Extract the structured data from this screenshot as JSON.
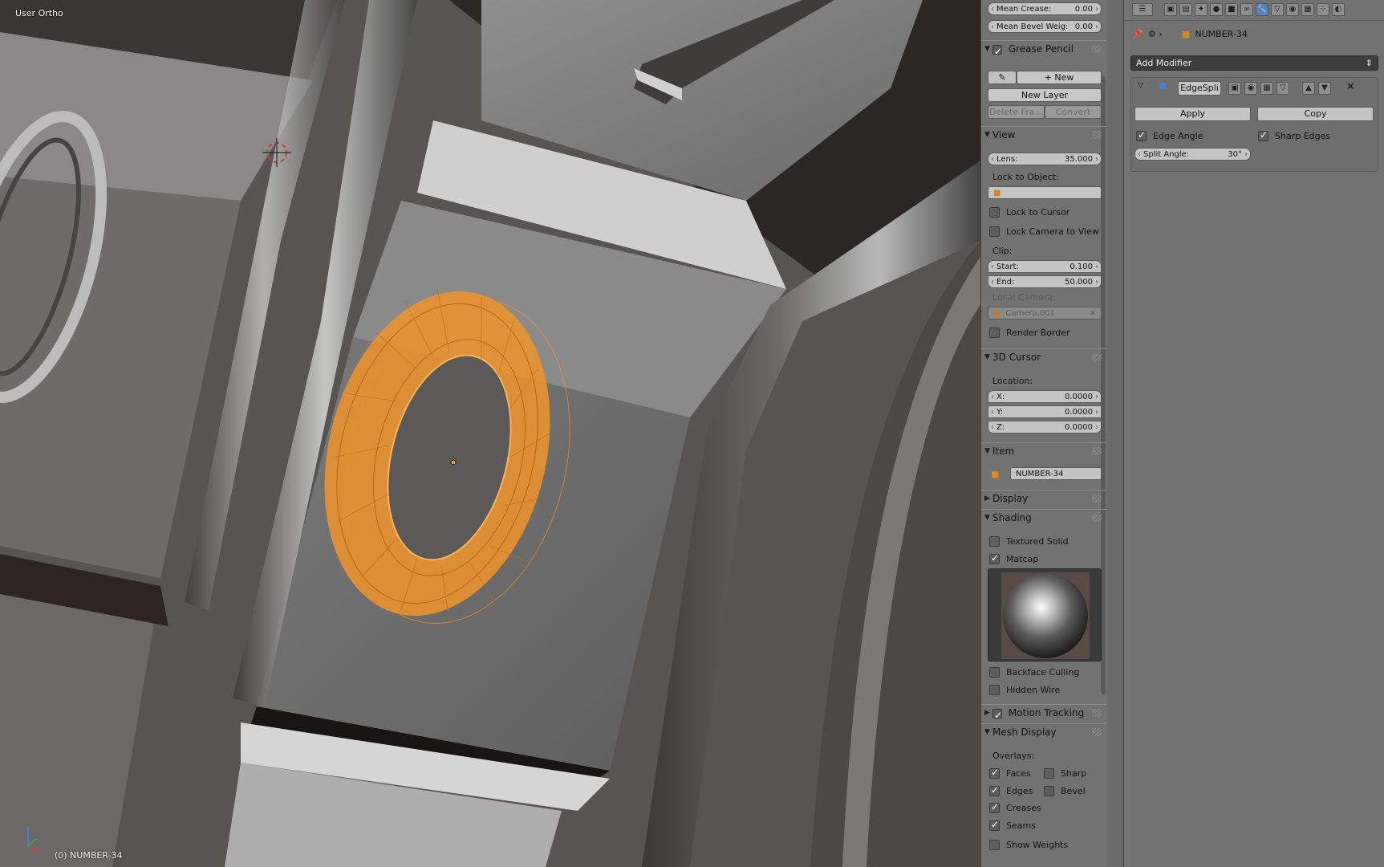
{
  "viewport": {
    "view_label": "User Ortho",
    "object_label": "(0) NUMBER-34"
  },
  "npanel": {
    "mean_crease_label": "Mean Crease:",
    "mean_crease_value": "0.00",
    "mean_bevel_label": "Mean Bevel Weig:",
    "mean_bevel_value": "0.00",
    "grease_pencil": {
      "title": "Grease Pencil",
      "new_label": "New",
      "new_layer_label": "New Layer",
      "delete_frame_label": "Delete Fra...",
      "convert_label": "Convert"
    },
    "view": {
      "title": "View",
      "lens_label": "Lens:",
      "lens_value": "35.000",
      "lock_to_object_label": "Lock to Object:",
      "lock_to_cursor_label": "Lock to Cursor",
      "lock_camera_label": "Lock Camera to View",
      "clip_label": "Clip:",
      "start_label": "Start:",
      "start_value": "0.100",
      "end_label": "End:",
      "end_value": "50.000",
      "local_camera_label": "Local Camera:",
      "local_camera_value": "Camera.001",
      "render_border_label": "Render Border"
    },
    "cursor": {
      "title": "3D Cursor",
      "location_label": "Location:",
      "x_label": "X:",
      "x_value": "0.0000",
      "y_label": "Y:",
      "y_value": "0.0000",
      "z_label": "Z:",
      "z_value": "0.0000"
    },
    "item": {
      "title": "Item",
      "name": "NUMBER-34"
    },
    "display_title": "Display",
    "shading": {
      "title": "Shading",
      "textured_solid_label": "Textured Solid",
      "matcap_label": "Matcap",
      "backface_culling_label": "Backface Culling",
      "hidden_wire_label": "Hidden Wire"
    },
    "motion_tracking_title": "Motion Tracking",
    "mesh_display": {
      "title": "Mesh Display",
      "overlays_label": "Overlays:",
      "faces_label": "Faces",
      "sharp_label": "Sharp",
      "edges_label": "Edges",
      "bevel_label": "Bevel",
      "creases_label": "Creases",
      "seams_label": "Seams",
      "show_weights_label": "Show Weights"
    }
  },
  "props": {
    "object_name": "NUMBER-34",
    "add_modifier_label": "Add Modifier",
    "modifier_name": "EdgeSpli",
    "apply_label": "Apply",
    "copy_label": "Copy",
    "edge_angle_label": "Edge Angle",
    "sharp_edges_label": "Sharp Edges",
    "split_angle_label": "Split Angle:",
    "split_angle_value": "30°"
  },
  "colors": {
    "selection": "#f0902a",
    "tab_active": "#5680c2"
  }
}
